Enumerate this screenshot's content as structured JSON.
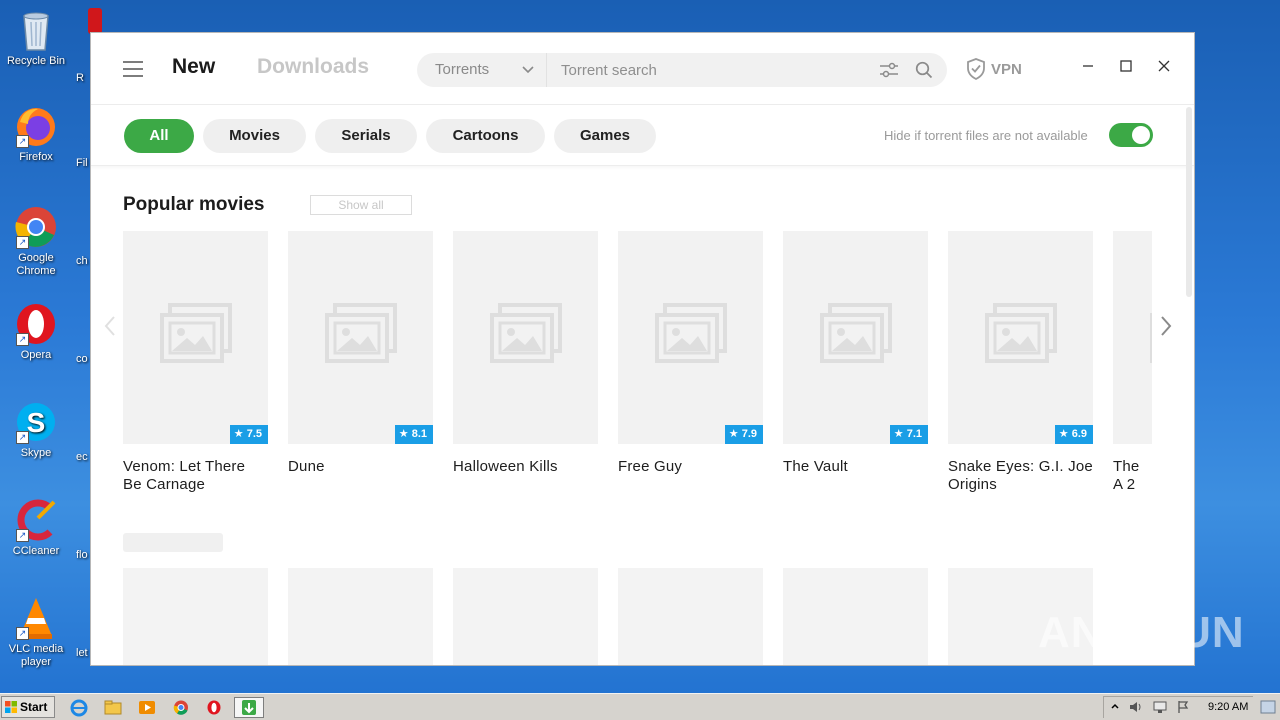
{
  "desktop": {
    "icons": [
      {
        "label": "Recycle Bin",
        "icon": "recycle-bin-icon"
      },
      {
        "label": "Firefox",
        "icon": "firefox-icon"
      },
      {
        "label": "Google Chrome",
        "icon": "chrome-icon"
      },
      {
        "label": "Opera",
        "icon": "opera-icon"
      },
      {
        "label": "Skype",
        "icon": "skype-icon"
      },
      {
        "label": "CCleaner",
        "icon": "ccleaner-icon"
      },
      {
        "label": "VLC media player",
        "icon": "vlc-icon"
      }
    ],
    "partial_labels": [
      "R",
      "Fil",
      "ch",
      "co",
      "ec",
      "flo",
      "let"
    ],
    "watermark": "ANY RUN"
  },
  "app": {
    "nav": {
      "new": "New",
      "downloads": "Downloads"
    },
    "search": {
      "type": "Torrents",
      "placeholder": "Torrent search"
    },
    "vpn_label": "VPN",
    "filters": [
      "All",
      "Movies",
      "Serials",
      "Cartoons",
      "Games"
    ],
    "active_filter": "All",
    "hide_label": "Hide if torrent files are not available",
    "hide_toggle_on": true,
    "section": {
      "title": "Popular movies",
      "show_all": "Show all"
    },
    "movies": [
      {
        "title": "Venom: Let There Be Carnage",
        "rating": "7.5"
      },
      {
        "title": "Dune",
        "rating": "8.1"
      },
      {
        "title": "Halloween Kills",
        "rating": ""
      },
      {
        "title": "Free Guy",
        "rating": "7.9"
      },
      {
        "title": "The Vault",
        "rating": "7.1"
      },
      {
        "title": "Snake Eyes: G.I. Joe Origins",
        "rating": "6.9"
      },
      {
        "title": "The A 2",
        "rating": ""
      }
    ],
    "colors": {
      "accent_green": "#3ca946",
      "rating_blue": "#1a9ee6"
    }
  },
  "taskbar": {
    "start_label": "Start",
    "clock": "9:20 AM",
    "pinned": [
      "ie-icon",
      "explorer-icon",
      "media-player-icon",
      "chrome-icon",
      "opera-icon",
      "torrent-app-icon"
    ]
  }
}
